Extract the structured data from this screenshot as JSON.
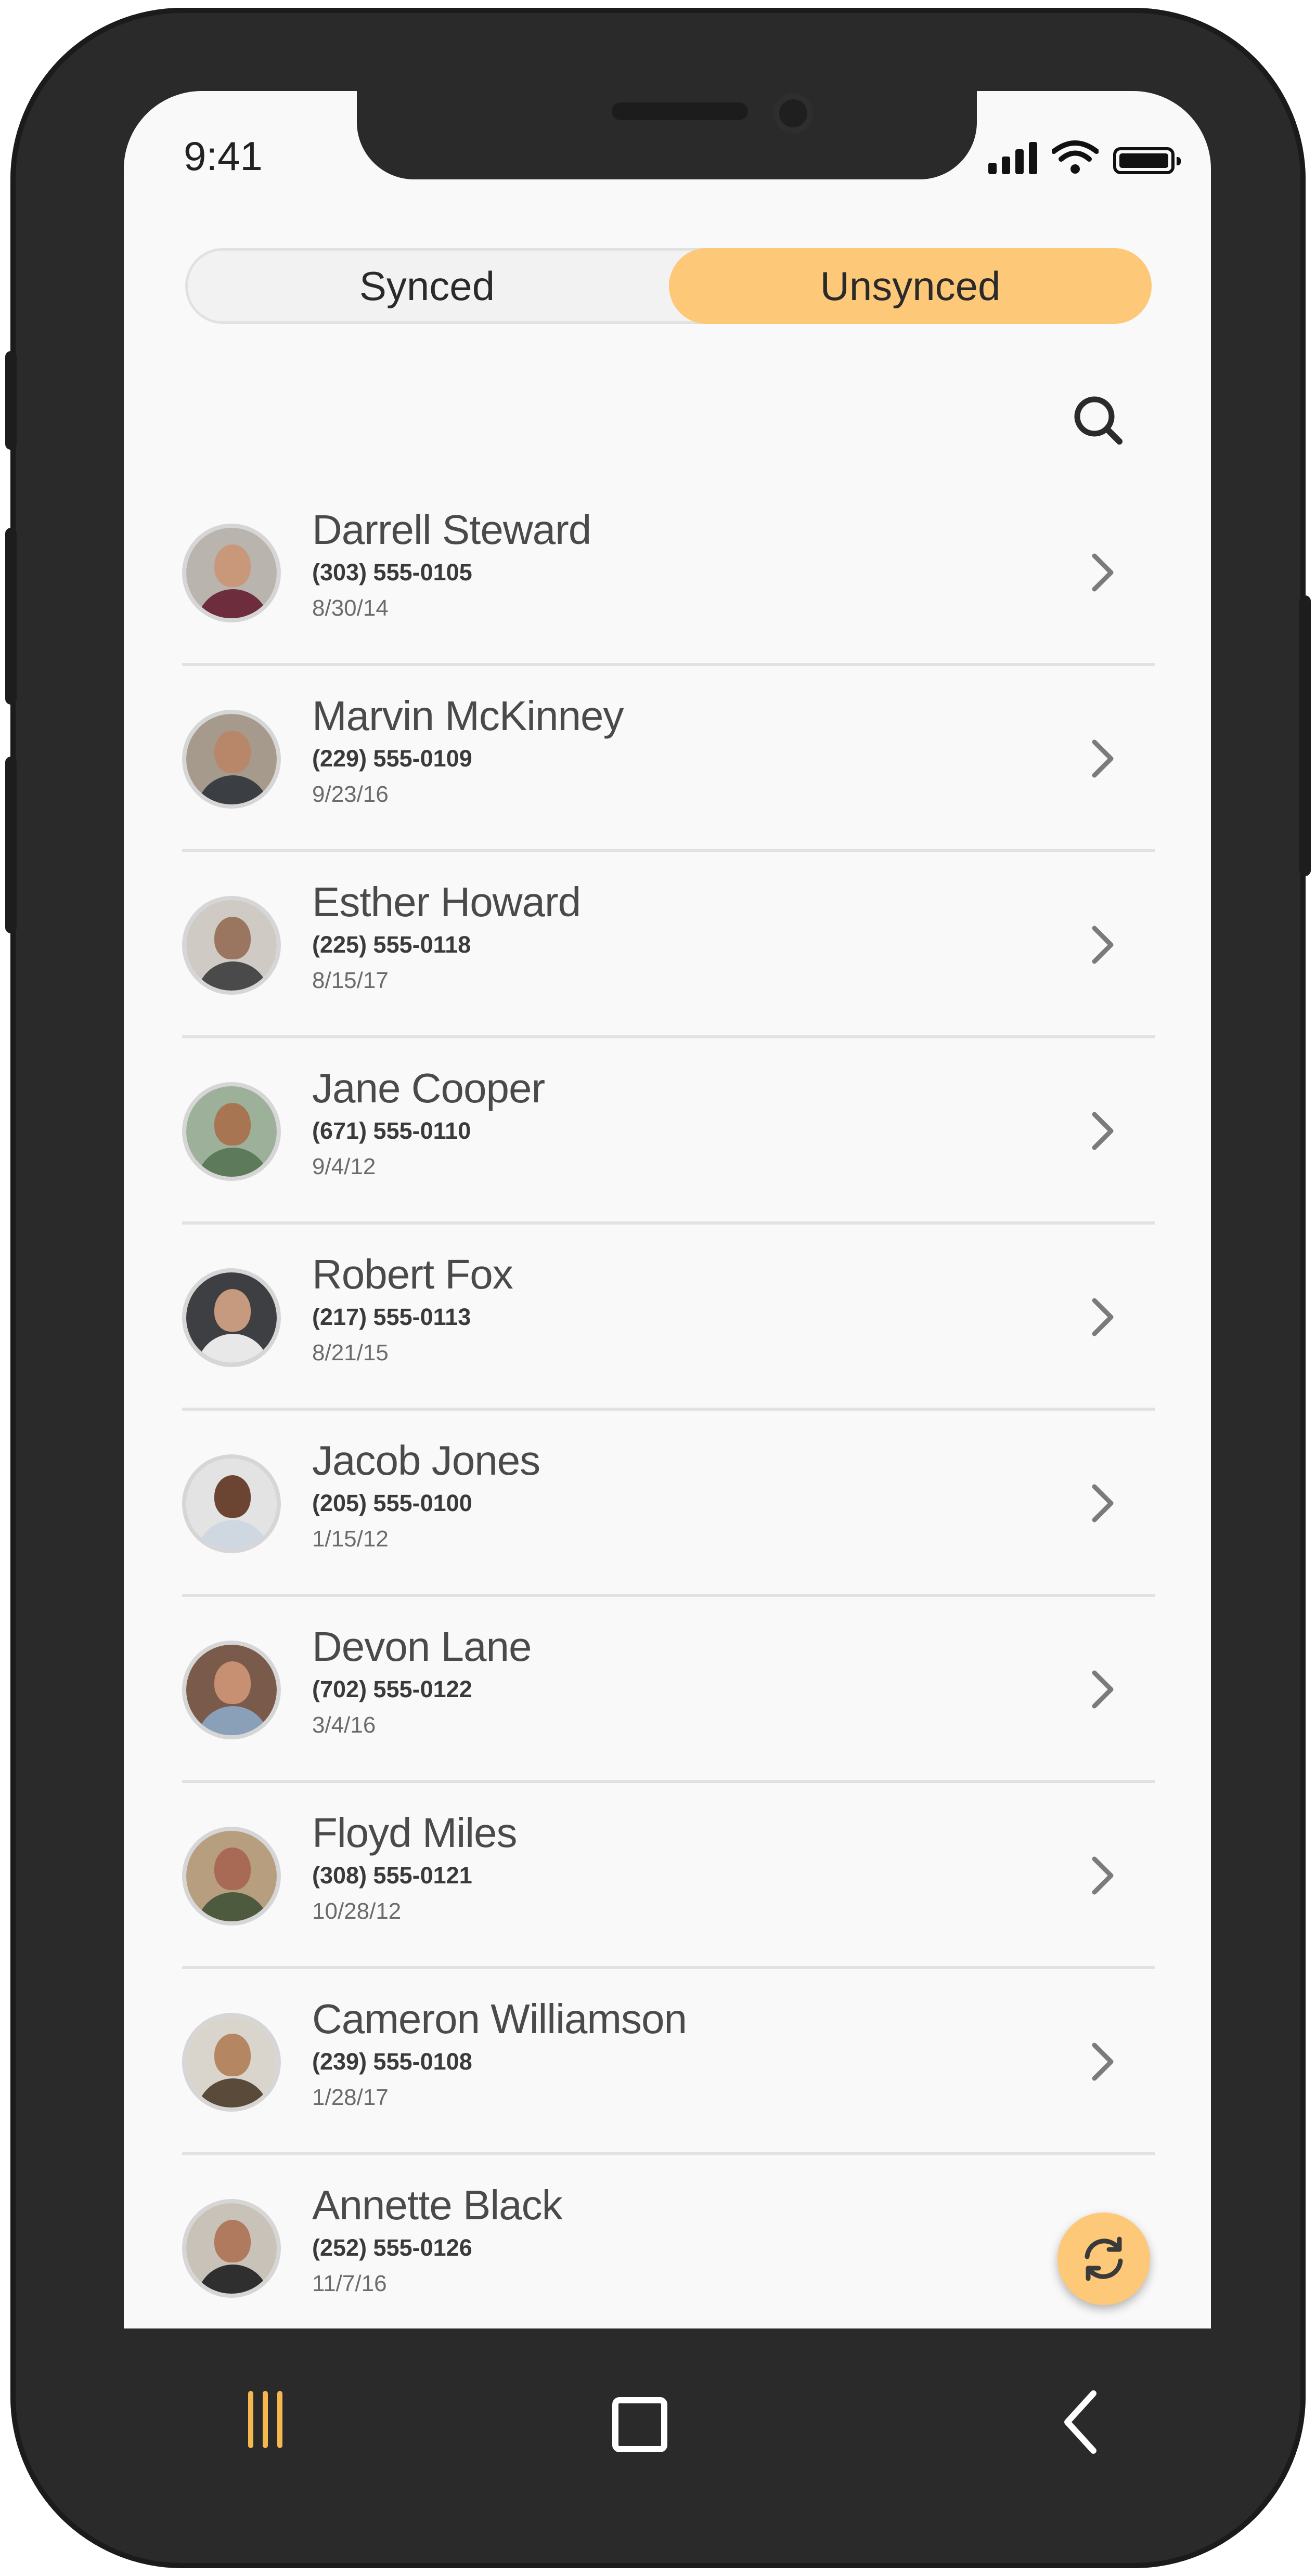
{
  "status_bar": {
    "time": "9:41"
  },
  "tabs": [
    {
      "label": "Synced",
      "active": false
    },
    {
      "label": "Unsynced",
      "active": true
    }
  ],
  "accent_color": "#fdc877",
  "search": {
    "icon": "search-icon"
  },
  "contacts": [
    {
      "name": "Darrell Steward",
      "phone": "(303) 555-0105",
      "date": "8/30/14"
    },
    {
      "name": "Marvin McKinney",
      "phone": "(229) 555-0109",
      "date": "9/23/16"
    },
    {
      "name": "Esther Howard",
      "phone": "(225) 555-0118",
      "date": "8/15/17"
    },
    {
      "name": "Jane Cooper",
      "phone": "(671) 555-0110",
      "date": "9/4/12"
    },
    {
      "name": "Robert Fox",
      "phone": "(217) 555-0113",
      "date": "8/21/15"
    },
    {
      "name": "Jacob Jones",
      "phone": "(205) 555-0100",
      "date": "1/15/12"
    },
    {
      "name": "Devon Lane",
      "phone": "(702) 555-0122",
      "date": "3/4/16"
    },
    {
      "name": "Floyd Miles",
      "phone": "(308) 555-0121",
      "date": "10/28/12"
    },
    {
      "name": "Cameron Williamson",
      "phone": "(239) 555-0108",
      "date": "1/28/17"
    },
    {
      "name": "Annette Black",
      "phone": "(252) 555-0126",
      "date": "11/7/16"
    }
  ],
  "fab": {
    "icon": "sync-icon"
  },
  "nav": {
    "items": [
      "recent-apps-icon",
      "home-icon",
      "back-icon"
    ]
  }
}
